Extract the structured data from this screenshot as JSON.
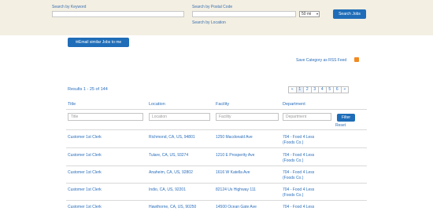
{
  "search": {
    "keyword_label": "Search by Keyword",
    "postal_label": "Search by Postal Code",
    "radius_value": "50 mi",
    "button_label": "Search Jobs",
    "location_link": "Search by Location"
  },
  "email_button_label": "✉Email similar Jobs to me",
  "rss_label": "Save Category as RSS Feed",
  "results_label": "Results 1 - 25 of 144",
  "pagination": [
    "«",
    "1",
    "2",
    "3",
    "4",
    "5",
    "6",
    "»"
  ],
  "columns": {
    "title": "Title",
    "location": "Location",
    "facility": "Facility",
    "department": "Department"
  },
  "filters": {
    "title_placeholder": "Title",
    "location_placeholder": "Location",
    "facility_placeholder": "Facility",
    "department_placeholder": "Department",
    "filter_button": "Filter",
    "reset_link": "Reset"
  },
  "rows": [
    {
      "title": "Customer 1st Clerk",
      "location": "Richmond, CA, US, 94801",
      "facility": "1250 Macdonald Ave",
      "department_1": "704 - Food 4 Less",
      "department_2": "(Foods Co.)"
    },
    {
      "title": "Customer 1st Clerk",
      "location": "Tulare, CA, US, 93274",
      "facility": "1210 E Prosperity Ave",
      "department_1": "704 - Food 4 Less",
      "department_2": "(Foods Co.)"
    },
    {
      "title": "Customer 1st Clerk",
      "location": "Anaheim, CA, US, 92802",
      "facility": "1616 W Katella Ave",
      "department_1": "704 - Food 4 Less",
      "department_2": "(Foods Co.)"
    },
    {
      "title": "Customer 1st Clerk",
      "location": "Indio, CA, US, 92201",
      "facility": "82124 Us Highway 111",
      "department_1": "704 - Food 4 Less",
      "department_2": "(Foods Co.)"
    },
    {
      "title": "Customer 1st Clerk",
      "location": "Hawthorne, CA, US, 90250",
      "facility": "14500 Ocean Gate Ave",
      "department_1": "704 - Food 4 Less",
      "department_2": ""
    }
  ]
}
